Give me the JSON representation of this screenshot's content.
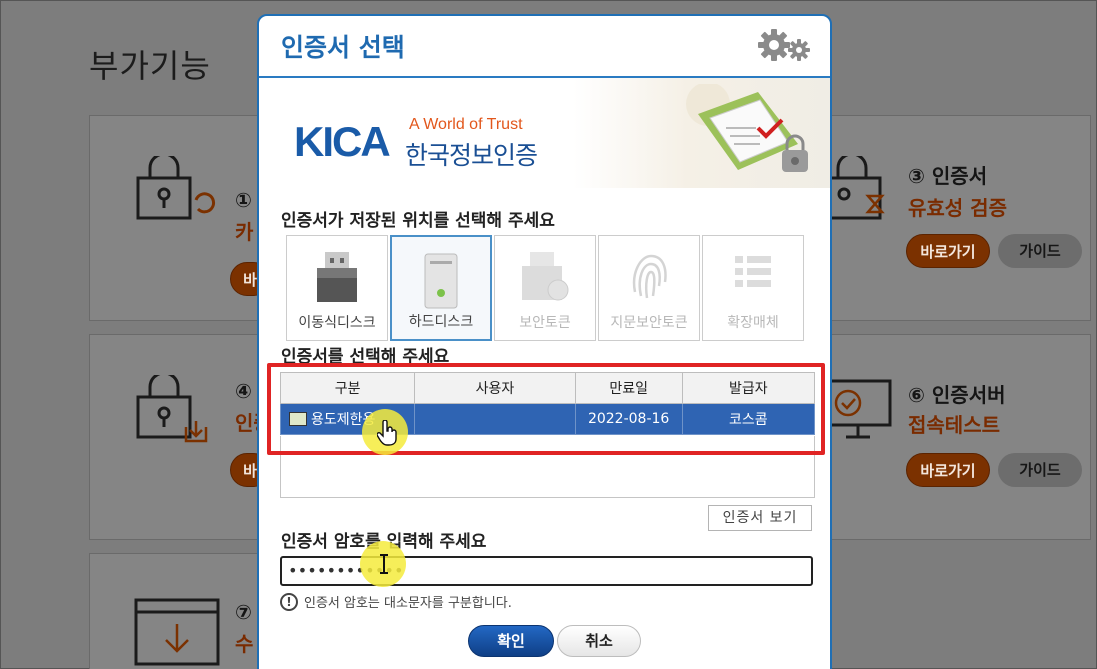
{
  "background": {
    "title": "부가기능",
    "cards": [
      {
        "num": "①",
        "sub": "카",
        "go": "바",
        "guide": ""
      },
      {
        "num": "③ 인증서",
        "sub": "유효성 검증",
        "go": "바로가기",
        "guide": "가이드"
      },
      {
        "num": "④",
        "sub": "인증",
        "go": "바",
        "guide": ""
      },
      {
        "num": "⑥ 인증서버",
        "sub": "접속테스트",
        "go": "바로가기",
        "guide": "가이드"
      },
      {
        "num": "⑦",
        "sub": "수",
        "go": "",
        "guide": ""
      }
    ]
  },
  "dialog": {
    "title": "인증서 선택",
    "brand": {
      "tagline": "A World of Trust",
      "name_kr": "한국정보인증",
      "logo": "KICA"
    },
    "location_label": "인증서가 저장된 위치를 선택해 주세요",
    "storage": [
      {
        "label": "이동식디스크",
        "icon": "usb-icon",
        "state": "normal"
      },
      {
        "label": "하드디스크",
        "icon": "hard-disk-icon",
        "state": "selected"
      },
      {
        "label": "보안토큰",
        "icon": "security-token-icon",
        "state": "disabled"
      },
      {
        "label": "지문보안토큰",
        "icon": "fingerprint-icon",
        "state": "disabled"
      },
      {
        "label": "확장매체",
        "icon": "extended-media-icon",
        "state": "disabled"
      }
    ],
    "cert_label": "인증서를 선택해 주세요",
    "table": {
      "headers": [
        "구분",
        "사용자",
        "만료일",
        "발급자"
      ],
      "rows": [
        {
          "type": "용도제한용",
          "user": "",
          "expiry": "2022-08-16",
          "issuer": "코스콤"
        }
      ]
    },
    "view_button": "인증서 보기",
    "password_label": "인증서 암호를 입력해 주세요",
    "password_value": "••••••••••••",
    "hint": "인증서 암호는 대소문자를 구분합니다.",
    "hint_icon": "!",
    "ok": "확인",
    "cancel": "취소"
  },
  "colors": {
    "accent": "#1f6ab0",
    "selection": "#2f64b3",
    "highlight": "#e02424"
  }
}
